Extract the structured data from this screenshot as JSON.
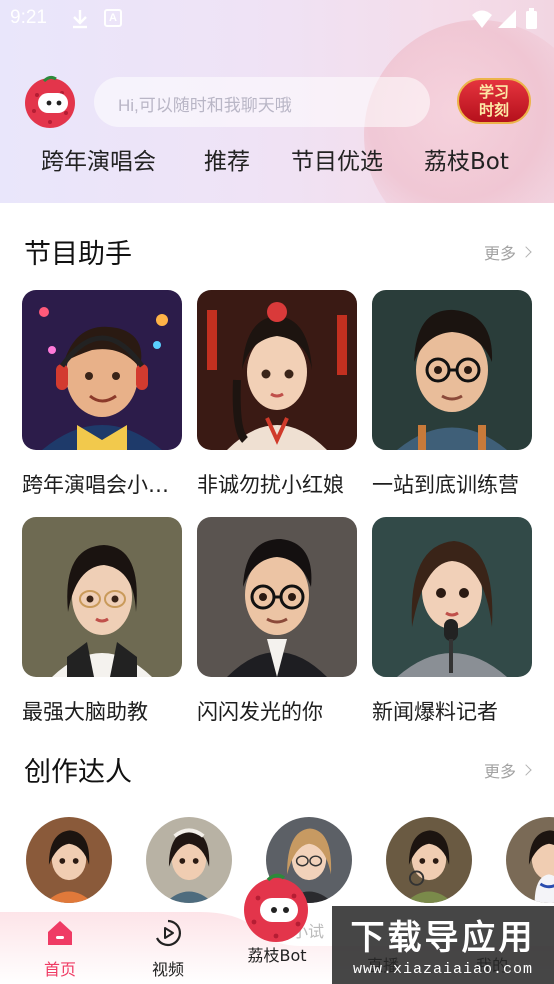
{
  "status_bar": {
    "time": "9:21",
    "icons": [
      "download-icon",
      "a-badge-icon",
      "wifi-icon",
      "signal-icon",
      "battery-icon"
    ]
  },
  "header": {
    "search_placeholder": "Hi,可以随时和我聊天哦",
    "badge_text_line1": "学习",
    "badge_text_line2": "时刻",
    "tabs": [
      "跨年演唱会",
      "推荐",
      "节目优选",
      "荔枝Bot"
    ]
  },
  "program_assistant": {
    "title": "节目助手",
    "more": "更多",
    "cards": [
      {
        "label": "跨年演唱会小助手"
      },
      {
        "label": "非诚勿扰小红娘"
      },
      {
        "label": "一站到底训练营"
      },
      {
        "label": "最强大脑助教"
      },
      {
        "label": "闪闪发光的你"
      },
      {
        "label": "新闻爆料记者"
      }
    ]
  },
  "creators": {
    "title": "创作达人",
    "more": "更多",
    "partial_name": "小试"
  },
  "bottom_nav": {
    "items": [
      {
        "label": "首页",
        "active": true
      },
      {
        "label": "视频",
        "active": false
      },
      {
        "label": "荔枝Bot",
        "active": false
      },
      {
        "label": "直播",
        "active": false
      },
      {
        "label": "我的",
        "active": false
      }
    ]
  },
  "watermark": {
    "title": "下载导应用",
    "url": "www.xiazaiaiao.com"
  },
  "colors": {
    "accent": "#ef3b64",
    "badge_red": "#d21f2b",
    "badge_gold": "#fde9a6",
    "header_gradient_start": "#e9e6fb",
    "header_gradient_end": "#f2d6e2"
  }
}
